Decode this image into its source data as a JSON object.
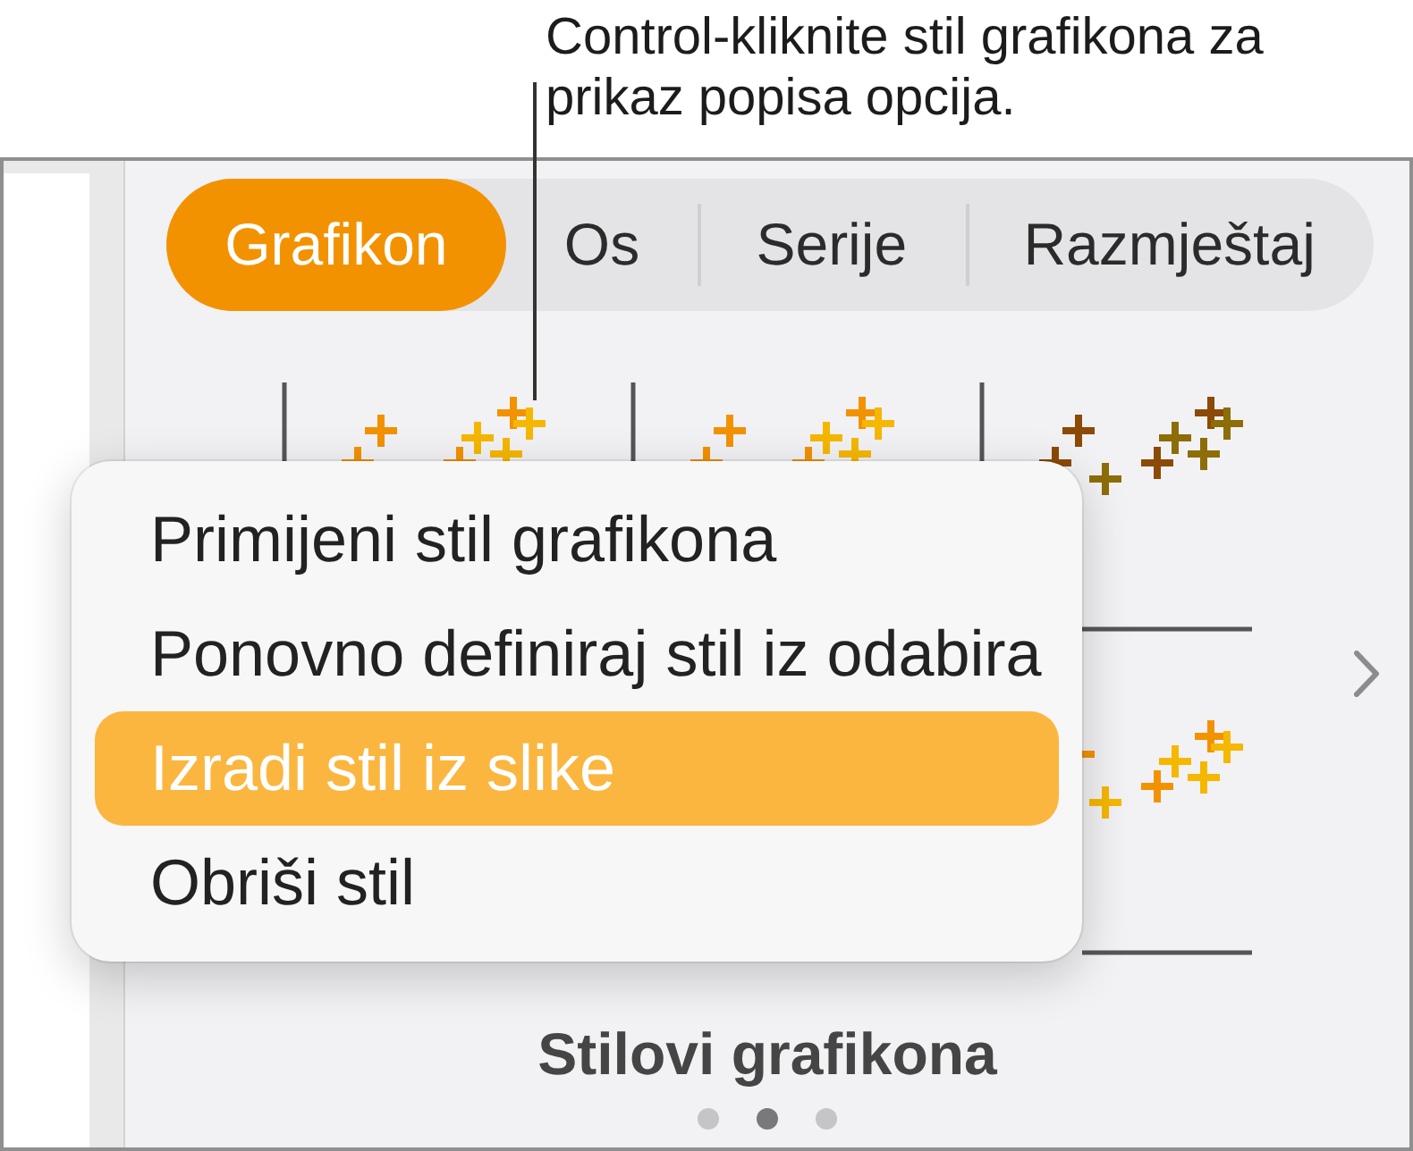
{
  "callout": {
    "text": "Control-kliknite stil grafikona za prikaz popisa opcija."
  },
  "tabs": [
    {
      "label": "Grafikon",
      "selected": true
    },
    {
      "label": "Os",
      "selected": false
    },
    {
      "label": "Serije",
      "selected": false
    },
    {
      "label": "Razmještaj",
      "selected": false
    }
  ],
  "context_menu": {
    "items": [
      {
        "label": "Primijeni stil grafikona",
        "selected": false
      },
      {
        "label": "Ponovno definiraj stil iz odabira",
        "selected": false
      },
      {
        "label": "Izradi stil iz slike",
        "selected": true
      },
      {
        "label": "Obriši stil",
        "selected": false
      }
    ]
  },
  "section_title": "Stilovi grafikona",
  "page_indicator": [
    {
      "selected": false
    },
    {
      "selected": true
    },
    {
      "selected": false
    }
  ]
}
